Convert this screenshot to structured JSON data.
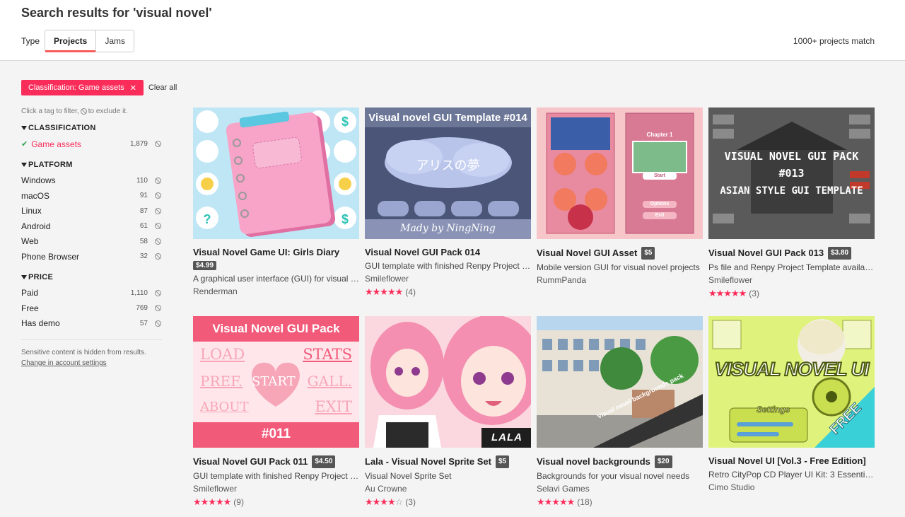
{
  "header": {
    "title": "Search results for 'visual novel'",
    "type_label": "Type",
    "tabs": [
      "Projects",
      "Jams"
    ],
    "match_count": "1000+ projects match"
  },
  "filters": {
    "active_tag": "Classification: Game assets",
    "clear_all": "Clear all"
  },
  "sidebar": {
    "hint_before": "Click a tag to filter,",
    "hint_after": "to exclude it.",
    "sections": [
      {
        "title": "CLASSIFICATION",
        "items": [
          {
            "name": "Game assets",
            "count": "1,879",
            "checked": true
          }
        ]
      },
      {
        "title": "PLATFORM",
        "items": [
          {
            "name": "Windows",
            "count": "110"
          },
          {
            "name": "macOS",
            "count": "91"
          },
          {
            "name": "Linux",
            "count": "87"
          },
          {
            "name": "Android",
            "count": "61"
          },
          {
            "name": "Web",
            "count": "58"
          },
          {
            "name": "Phone Browser",
            "count": "32"
          }
        ]
      },
      {
        "title": "PRICE",
        "items": [
          {
            "name": "Paid",
            "count": "1,110"
          },
          {
            "name": "Free",
            "count": "769"
          },
          {
            "name": "Has demo",
            "count": "57"
          }
        ]
      }
    ],
    "sensitive_text": "Sensitive content is hidden from results.",
    "sensitive_link": "Change in account settings"
  },
  "thumb_text": {
    "t2_title": "Visual novel GUI Template #014",
    "t2_center": "アリスの夢",
    "t2_footer": "Mady by NingNing",
    "t3_chapter": "Chapter 1",
    "t3_start": "Start",
    "t3_options": "Options",
    "t3_exit": "Exit",
    "t4_line1": "VISUAL NOVEL GUI PACK",
    "t4_line2": "#013",
    "t4_line3": "ASIAN STYLE GUI TEMPLATE",
    "t5_title": "Visual Novel GUI Pack",
    "t5_load": "LOAD",
    "t5_stats": "STATS",
    "t5_pref": "PREF.",
    "t5_start": "START",
    "t5_gall": "GALL.",
    "t5_about": "ABOUT",
    "t5_exit": "EXIT",
    "t5_num": "#011",
    "t6_name": "LALA",
    "t7_banner": "Visual novel backgrounds pack",
    "t8_title": "VISUAL NOVEL UI",
    "t8_settings": "Settings",
    "t8_free": "FREE"
  },
  "cards": [
    {
      "title": "Visual Novel Game UI: Girls Diary",
      "price": "$4.99",
      "desc": "A graphical user interface (GUI) for visual n...",
      "author": "Renderman",
      "stars": 0,
      "rating_count": ""
    },
    {
      "title": "Visual Novel GUI Pack 014",
      "price": "",
      "desc": "GUI template with finished Renpy Project (...",
      "author": "Smileflower",
      "stars": 5,
      "rating_count": "(4)"
    },
    {
      "title": "Visual Novel GUI Asset",
      "price": "$5",
      "desc": "Mobile version GUI for visual novel projects",
      "author": "RummPanda",
      "stars": 0,
      "rating_count": ""
    },
    {
      "title": "Visual Novel GUI Pack 013",
      "price": "$3.80",
      "desc": "Ps file and Renpy Project Template availabl...",
      "author": "Smileflower",
      "stars": 5,
      "rating_count": "(3)"
    },
    {
      "title": "Visual Novel GUI Pack 011",
      "price": "$4.50",
      "desc": "GUI template with finished Renpy Project (...",
      "author": "Smileflower",
      "stars": 5,
      "rating_count": "(9)"
    },
    {
      "title": "Lala - Visual Novel Sprite Set",
      "price": "$5",
      "desc": "Visual Novel Sprite Set",
      "author": "Au Crowne",
      "stars": 3.5,
      "rating_count": "(3)"
    },
    {
      "title": "Visual novel backgrounds",
      "price": "$20",
      "desc": "Backgrounds for your visual novel needs",
      "author": "Selavi Games",
      "stars": 5,
      "rating_count": "(18)"
    },
    {
      "title": "Visual Novel UI [Vol.3 - Free Edition]",
      "price": "",
      "desc": "Retro CityPop CD Player UI Kit: 3 Essentia...",
      "author": "Cimo Studio",
      "stars": 0,
      "rating_count": ""
    }
  ],
  "colors": {
    "accent": "#fa2d5a",
    "check": "#2ca34f"
  }
}
